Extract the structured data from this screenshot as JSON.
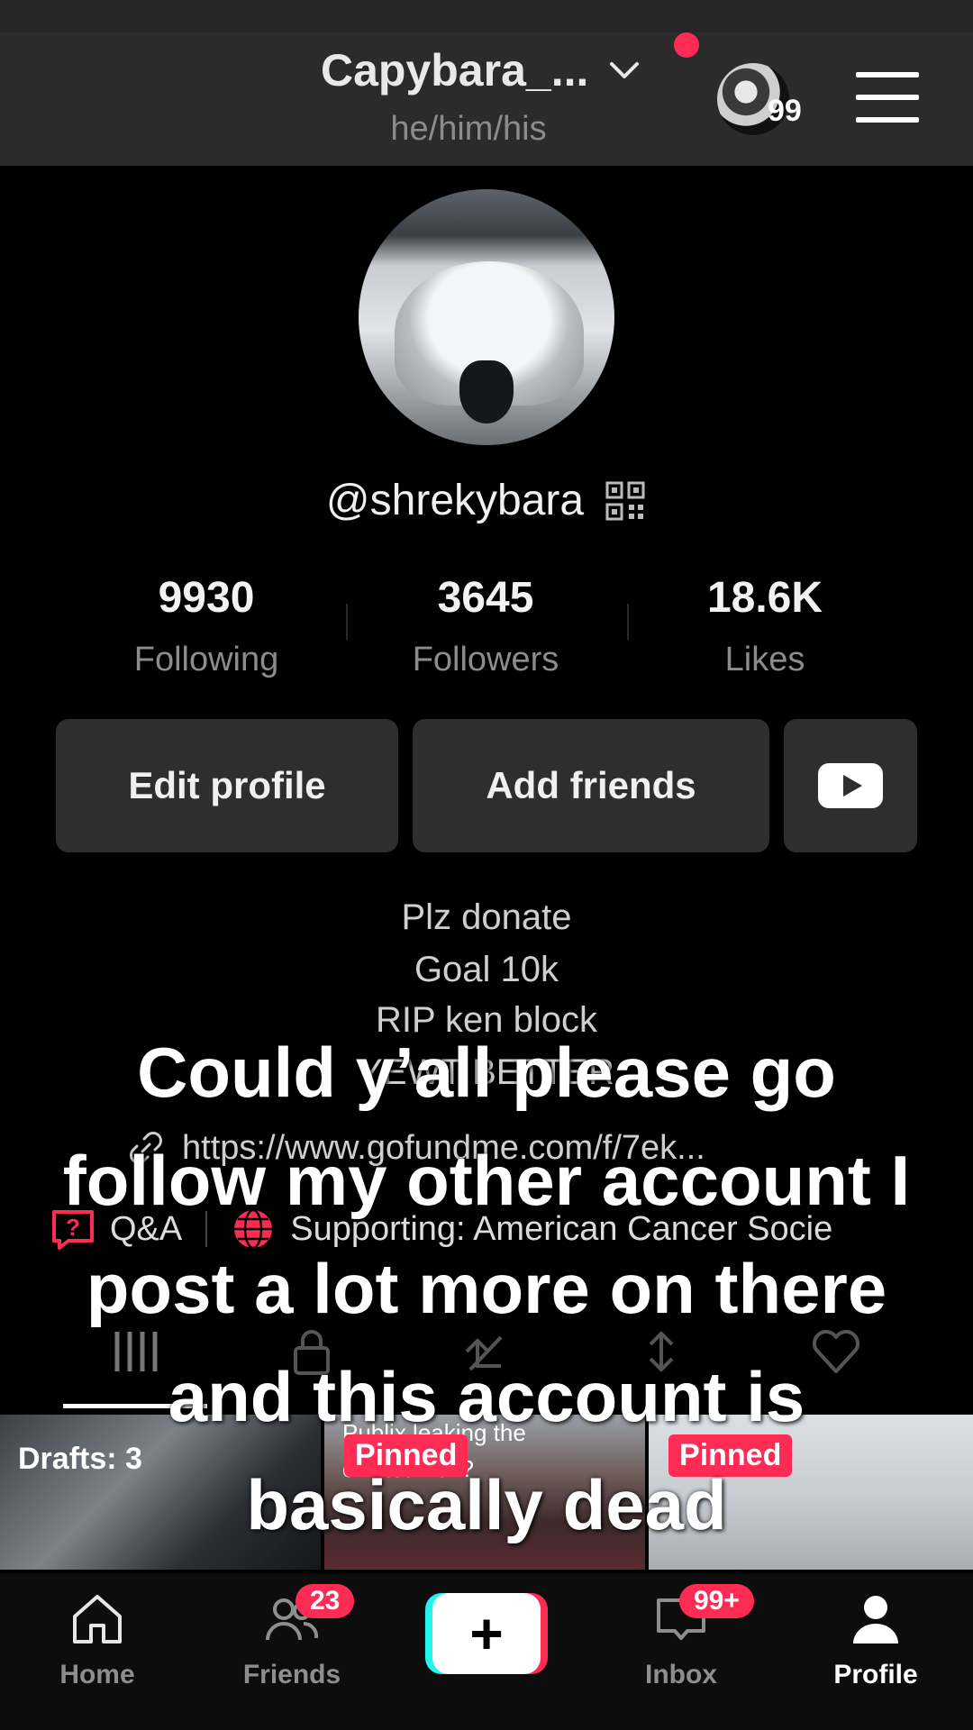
{
  "header": {
    "username": "Capybara_...",
    "pronouns": "he/him/his",
    "story_count": "99",
    "accent_color": "#fe2c55"
  },
  "profile": {
    "handle": "@shrekybara",
    "stats": [
      {
        "value": "9930",
        "label": "Following"
      },
      {
        "value": "3645",
        "label": "Followers"
      },
      {
        "value": "18.6K",
        "label": "Likes"
      }
    ],
    "buttons": {
      "edit": "Edit profile",
      "add_friends": "Add friends",
      "youtube_icon": "youtube-icon"
    },
    "bio_lines": [
      "Plz donate",
      "Goal 10k",
      "RIP ken block",
      "YEWT BETTER"
    ],
    "link": "https://www.gofundme.com/f/7ek...",
    "qa_label": "Q&A",
    "supporting": "Supporting: American Cancer Socie"
  },
  "tabs": [
    "videos-grid-icon",
    "lock-icon",
    "repost-icon",
    "favorites-icon",
    "liked-icon"
  ],
  "grid": {
    "drafts_label": "Drafts: 3",
    "pinned_label": "Pinned",
    "caption_2": "Publix leaking the\nowl teams??"
  },
  "overlay_text": "Could y’all please go follow my other account I post a lot more on there and this account is basically dead",
  "bottom_nav": {
    "home": "Home",
    "friends": "Friends",
    "friends_badge": "23",
    "inbox": "Inbox",
    "inbox_badge": "99+",
    "profile": "Profile"
  }
}
